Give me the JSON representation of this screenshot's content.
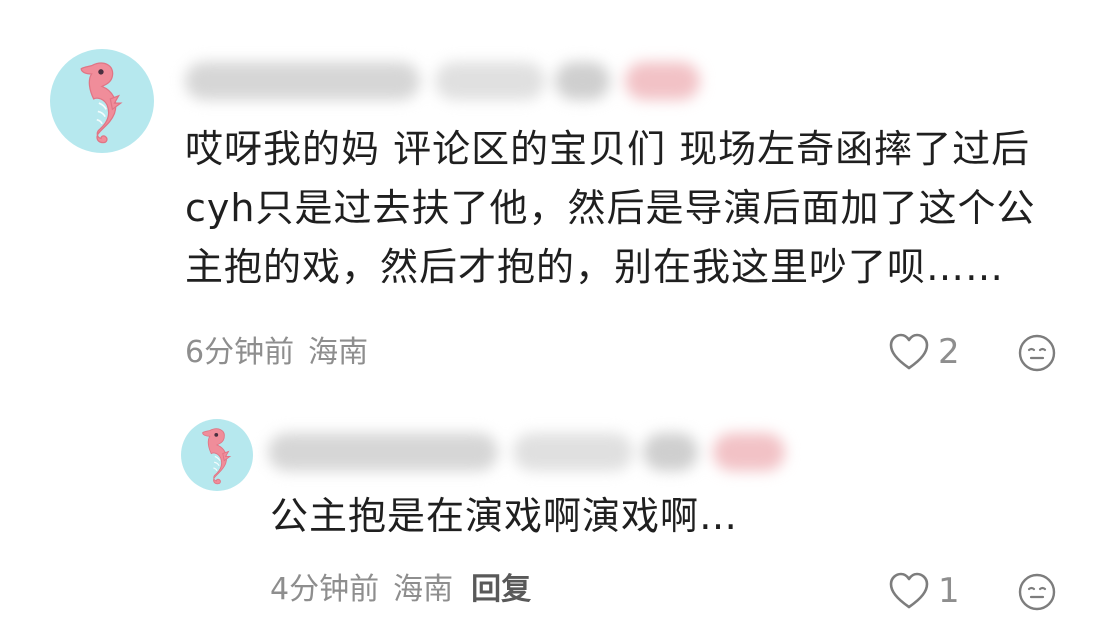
{
  "comments": [
    {
      "text_lines": [
        "哎呀我的妈 评论区的宝贝们 现场左奇函摔了过后",
        "cyh只是过去扶了他，然后是导演后面加了这个公",
        "主抱的戏，然后才抱的，别在我这里吵了呗……"
      ],
      "time": "6分钟前",
      "location": "海南",
      "like_count": "2"
    },
    {
      "text_lines": [
        "公主抱是在演戏啊演戏啊…"
      ],
      "time": "4分钟前",
      "location": "海南",
      "reply_label": "回复",
      "like_count": "1"
    }
  ],
  "colors": {
    "avatar_bg": "#b6e8ee",
    "seahorse": "#f08d9a",
    "text": "#1f1f1f",
    "meta": "#8e8e8e"
  },
  "icons": {
    "like": "heart-outline-icon",
    "emoji": "neutral-face-icon"
  }
}
